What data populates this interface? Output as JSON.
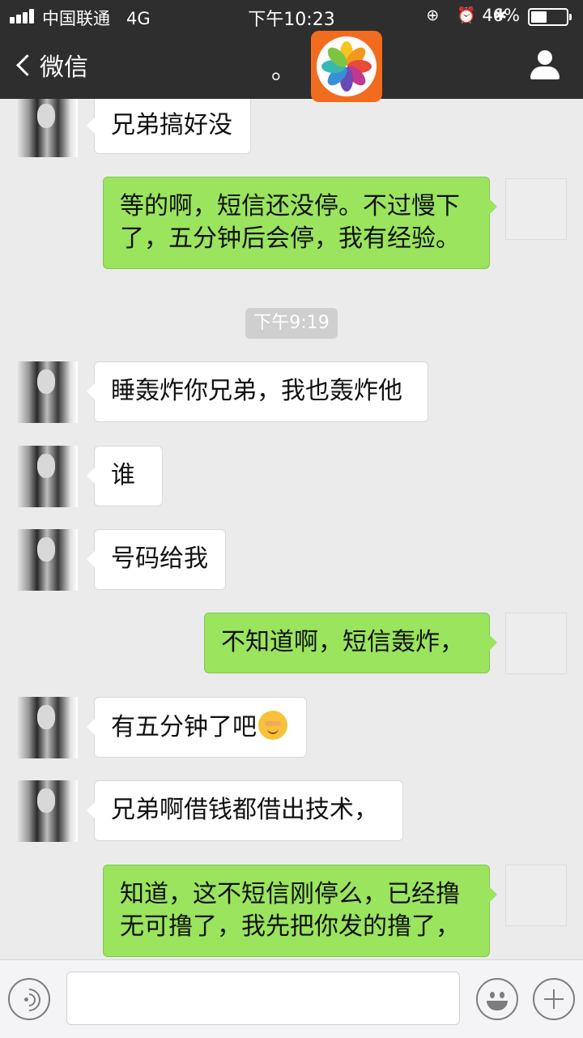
{
  "status_bar": {
    "carrier": "中国联通",
    "network": "4G",
    "time": "下午10:23",
    "status_icons": "⊕ ⏰ ✱",
    "battery_percent": "46%",
    "battery_level": 0.46
  },
  "nav": {
    "back_label": "微信",
    "title": "。"
  },
  "timestamp": "下午9:19",
  "messages": [
    {
      "side": "theirs",
      "text": "兄弟搞好没"
    },
    {
      "side": "mine",
      "lines": [
        "等的啊，短信还没停。不过慢下",
        "了，五分钟后会停，我有经验。"
      ]
    },
    {
      "side": "theirs",
      "text": "睡轰炸你兄弟，我也轰炸他"
    },
    {
      "side": "theirs",
      "text": "谁"
    },
    {
      "side": "theirs",
      "text": "号码给我"
    },
    {
      "side": "mine",
      "text": "不知道啊，短信轰炸，"
    },
    {
      "side": "theirs",
      "text": "有五分钟了吧"
    },
    {
      "side": "theirs",
      "text": "兄弟啊借钱都借出技术，"
    },
    {
      "side": "mine",
      "lines": [
        "知道，这不短信刚停么，已经撸",
        "无可撸了，我先把你发的撸了，"
      ]
    }
  ],
  "input": {
    "placeholder": ""
  },
  "icons": {
    "signal": "signal-bars-icon",
    "battery": "battery-icon",
    "back": "chevron-left-icon",
    "user": "user-icon",
    "app_badge": "pinwheel-app-icon",
    "voice": "voice-icon",
    "emoji": "emoji-icon",
    "more": "plus-icon"
  },
  "colors": {
    "nav_bg": "#2e2e2e",
    "chat_bg": "#ebebeb",
    "my_bubble": "#9ae45e",
    "their_bubble": "#ffffff",
    "badge": "#f26c1f"
  }
}
